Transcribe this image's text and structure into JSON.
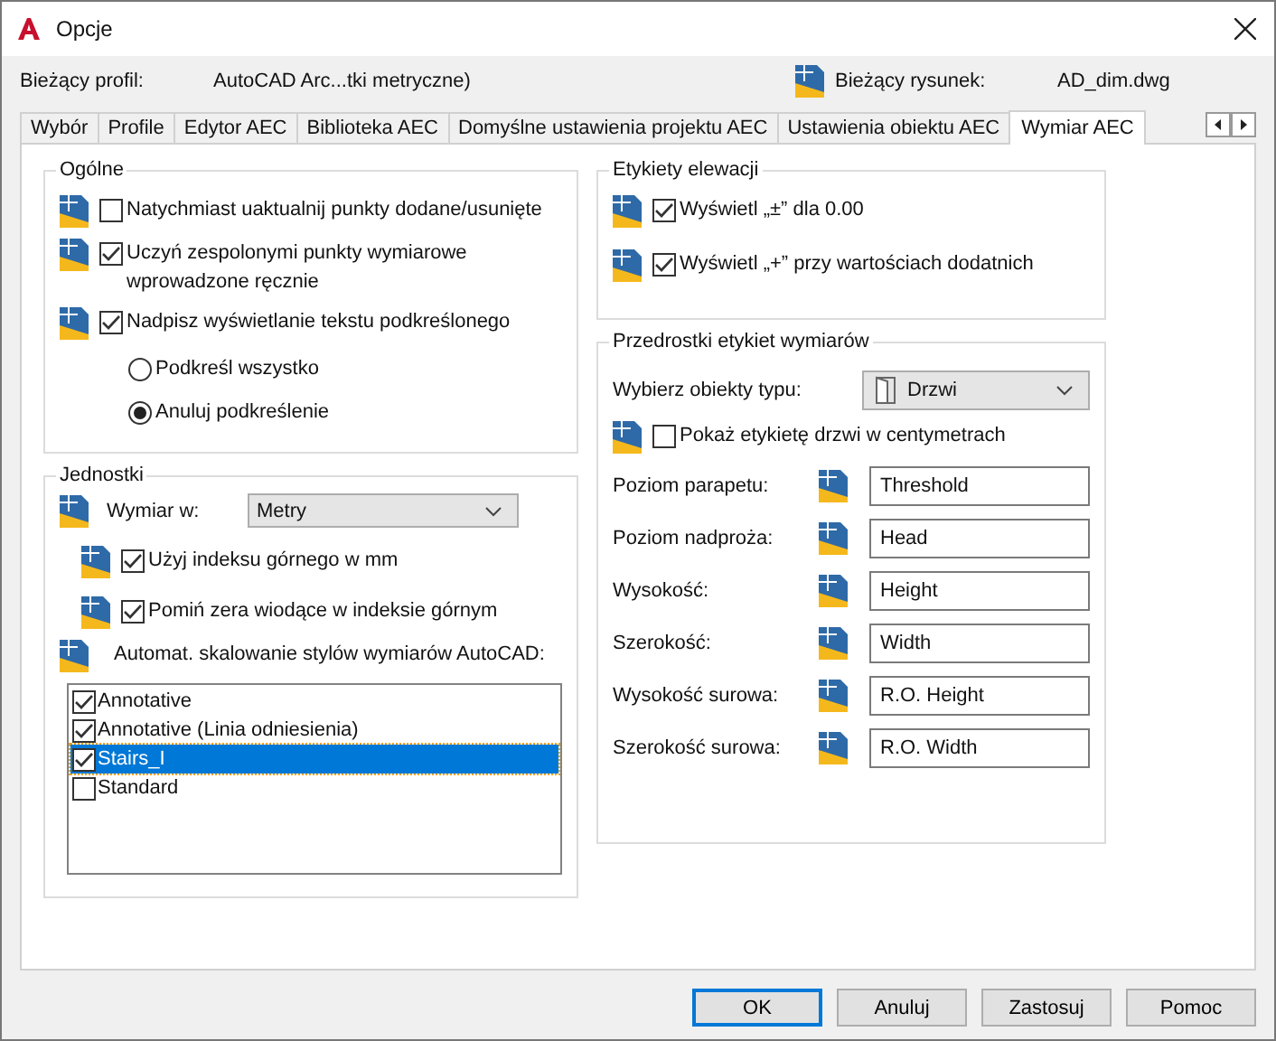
{
  "window": {
    "title": "Opcje"
  },
  "profile": {
    "label": "Bieżący profil:",
    "value": "AutoCAD Arc...tki metryczne)"
  },
  "drawing": {
    "label": "Bieżący rysunek:",
    "value": "AD_dim.dwg"
  },
  "tabs": [
    {
      "label": "Wybór",
      "selected": false
    },
    {
      "label": "Profile",
      "selected": false
    },
    {
      "label": "Edytor AEC",
      "selected": false
    },
    {
      "label": "Biblioteka AEC",
      "selected": false
    },
    {
      "label": "Domyślne ustawienia projektu AEC",
      "selected": false
    },
    {
      "label": "Ustawienia obiektu AEC",
      "selected": false
    },
    {
      "label": "Wymiar AEC",
      "selected": true
    }
  ],
  "general": {
    "title": "Ogólne",
    "options": [
      {
        "kind": "checkbox",
        "label": "Natychmiast uaktualnij punkty dodane/usunięte",
        "checked": false
      },
      {
        "kind": "checkbox",
        "label": "Uczyń zespolonymi punkty wymiarowe wprowadzone ręcznie",
        "checked": true
      },
      {
        "kind": "checkbox",
        "label": "Nadpisz wyświetlanie tekstu podkreślonego",
        "checked": true
      },
      {
        "kind": "radio",
        "label": "Podkreśl wszystko",
        "selected": false
      },
      {
        "kind": "radio",
        "label": "Anuluj podkreślenie",
        "selected": true
      }
    ]
  },
  "units": {
    "title": "Jednostki",
    "dimension_label": "Wymiar w:",
    "dimension_value": "Metry",
    "options": [
      {
        "label": "Użyj indeksu górnego w mm",
        "checked": true
      },
      {
        "label": "Pomiń zera wiodące w indeksie górnym",
        "checked": true
      }
    ],
    "scaling_label": "Automat. skalowanie stylów wymiarów AutoCAD:",
    "styles": [
      {
        "label": "Annotative",
        "checked": true,
        "selected": false
      },
      {
        "label": "Annotative (Linia odniesienia)",
        "checked": true,
        "selected": false
      },
      {
        "label": "Stairs_I",
        "checked": true,
        "selected": true
      },
      {
        "label": "Standard",
        "checked": false,
        "selected": false
      }
    ]
  },
  "elevation": {
    "title": "Etykiety elewacji",
    "options": [
      {
        "label": "Wyświetl „±” dla 0.00",
        "checked": true
      },
      {
        "label": "Wyświetl „+” przy wartościach dodatnich",
        "checked": true
      }
    ]
  },
  "prefixes": {
    "title": "Przedrostki etykiet wymiarów",
    "object_type_label": "Wybierz obiekty typu:",
    "object_type_value": "Drzwi",
    "show_cm": {
      "label": "Pokaż etykietę drzwi w centymetrach",
      "checked": false
    },
    "fields": [
      {
        "label": "Poziom parapetu:",
        "value": "Threshold"
      },
      {
        "label": "Poziom nadproża:",
        "value": "Head"
      },
      {
        "label": "Wysokość:",
        "value": "Height"
      },
      {
        "label": "Szerokość:",
        "value": "Width"
      },
      {
        "label": "Wysokość surowa:",
        "value": "R.O. Height"
      },
      {
        "label": "Szerokość surowa:",
        "value": "R.O. Width"
      }
    ]
  },
  "buttons": [
    {
      "label": "OK",
      "default": true
    },
    {
      "label": "Anuluj",
      "default": false
    },
    {
      "label": "Zastosuj",
      "default": false
    },
    {
      "label": "Pomoc",
      "default": false
    }
  ]
}
